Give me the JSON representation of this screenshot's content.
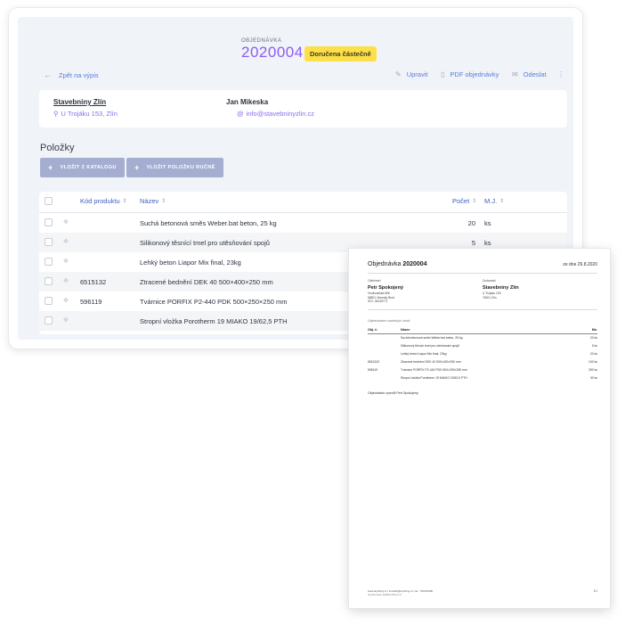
{
  "order": {
    "label": "OBJEDNÁVKA",
    "number": "2020004",
    "status": "Doručena částečně"
  },
  "toolbar": {
    "back": "Zpět na výpis",
    "edit": "Upravit",
    "pdf": "PDF objednávky",
    "send": "Odeslat"
  },
  "supplier": {
    "name": "Stavebniny Zlín",
    "address": "U Trojáku 153, Zlín",
    "contact": "Jan Mikeska",
    "email": "info@stavebninyzlin.cz"
  },
  "items_section": {
    "title": "Položky",
    "btn_catalog": "VLOŽIT Z KATALOGU",
    "btn_manual": "VLOŽIT POLOŽKU RUČNĚ"
  },
  "table": {
    "headers": {
      "code": "Kód produktu",
      "name": "Název",
      "qty": "Počet",
      "unit": "M.J."
    },
    "rows": [
      {
        "code": "",
        "name": "Suchá betonová směs Weber.bat beton, 25 kg",
        "qty": "20",
        "unit": "ks"
      },
      {
        "code": "",
        "name": "Silikonový těsnící tmel pro utěsňování spojů",
        "qty": "5",
        "unit": "ks"
      },
      {
        "code": "",
        "name": "Lehký beton Liapor Mix final, 23kg",
        "qty": "",
        "unit": ""
      },
      {
        "code": "6515132",
        "name": "Ztracené bednění DEK 40 500×400×250 mm",
        "qty": "",
        "unit": ""
      },
      {
        "code": "596119",
        "name": "Tvárnice PORFIX P2-440 PDK 500×250×250 mm",
        "qty": "",
        "unit": ""
      },
      {
        "code": "",
        "name": "Stropní vložka Porotherm 19 MIAKO 19/62,5 PTH",
        "qty": "",
        "unit": ""
      }
    ]
  },
  "document": {
    "title_prefix": "Objednávka",
    "title_number": "2020004",
    "date": "ze dne 29.8.2020",
    "buyer_label": "Odběratel",
    "buyer_name": "Petr Spokojený",
    "buyer_address": "Vinohradská 666\n68801 Uherský Brod\nIČO: 04239771",
    "supplier_label": "Dodavatel",
    "supplier_name": "Stavebniny Zlín",
    "supplier_address": "U Trojáku 153\n76001 Zlín",
    "note": "Objednáváme následující zboží:",
    "headers": {
      "code": "Obj. č.",
      "name": "Název",
      "qty": "Mn."
    },
    "rows": [
      {
        "code": "",
        "name": "Suchá betonová směs Weber.bat beton, 25 kg",
        "qty": "20 ks"
      },
      {
        "code": "",
        "name": "Silikonový těsnící tmel pro utěsňování spojů",
        "qty": "5 ks"
      },
      {
        "code": "",
        "name": "Lehký beton Liapor Mix final, 23kg",
        "qty": "20 ks"
      },
      {
        "code": "6515132",
        "name": "Ztracené bednění DEK 40 500×400×250 mm",
        "qty": "100 ks"
      },
      {
        "code": "596119",
        "name": "Tvárnice PORFIX P2-440 PDK 500×250×250 mm",
        "qty": "250 ks"
      },
      {
        "code": "",
        "name": "Stropní vložka Porotherm 19 MIAKO 19/62,5 PTH",
        "qty": "30 ks"
      }
    ],
    "created_by": "Objednávku vytvořil Petr Spokojený",
    "footer": "www.anything.cz  |  kontakt@anything.cz  |  tel.: 700123480",
    "footer2": "Generováno aplikací Plevo.cz",
    "page": "1/1"
  }
}
